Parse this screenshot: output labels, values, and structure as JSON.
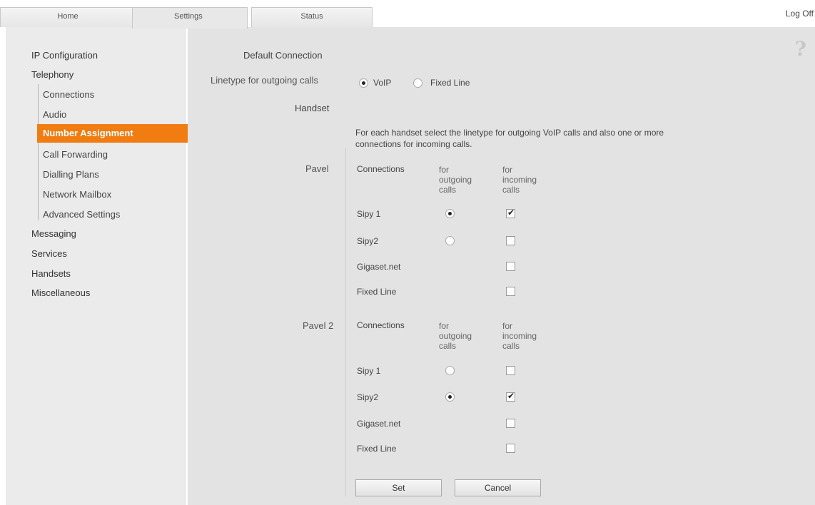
{
  "tabs": {
    "home": "Home",
    "settings": "Settings",
    "status": "Status"
  },
  "logoff": "Log Off",
  "help_icon": "?",
  "nav": {
    "ip_configuration": "IP Configuration",
    "telephony": "Telephony",
    "connections": "Connections",
    "audio": "Audio",
    "number_assignment": "Number Assignment",
    "call_forwarding": "Call Forwarding",
    "dialling_plans": "Dialling Plans",
    "network_mailbox": "Network Mailbox",
    "advanced_settings": "Advanced Settings",
    "messaging": "Messaging",
    "services": "Services",
    "handsets": "Handsets",
    "miscellaneous": "Miscellaneous"
  },
  "default_connection": {
    "title": "Default Connection",
    "linetype_label": "Linetype for outgoing calls",
    "voip": "VoIP",
    "fixed_line": "Fixed Line",
    "selected": "VoIP"
  },
  "handset": {
    "title": "Handset",
    "description_line1": "For each handset select the linetype for outgoing VoIP calls and also one or more",
    "description_line2": "connections for incoming calls.",
    "col_connections": "Connections",
    "col_outgoing_1": "for",
    "col_outgoing_2": "outgoing",
    "col_outgoing_3": "calls",
    "col_incoming_1": "for",
    "col_incoming_2": "incoming",
    "col_incoming_3": "calls"
  },
  "handsets": [
    {
      "name": "Pavel",
      "rows": [
        {
          "connection": "Sipy 1",
          "outgoing": true,
          "incoming": true
        },
        {
          "connection": "Sipy2",
          "outgoing": false,
          "incoming": false
        },
        {
          "connection": "Gigaset.net",
          "incoming": false
        },
        {
          "connection": "Fixed Line",
          "incoming": false
        }
      ]
    },
    {
      "name": "Pavel 2",
      "rows": [
        {
          "connection": "Sipy 1",
          "outgoing": false,
          "incoming": false
        },
        {
          "connection": "Sipy2",
          "outgoing": true,
          "incoming": true
        },
        {
          "connection": "Gigaset.net",
          "incoming": false
        },
        {
          "connection": "Fixed Line",
          "incoming": false
        }
      ]
    }
  ],
  "buttons": {
    "set": "Set",
    "cancel": "Cancel"
  },
  "colors": {
    "accent": "#f07c12",
    "sidebar_bg": "#ebebeb",
    "content_bg": "#e3e3e3"
  }
}
